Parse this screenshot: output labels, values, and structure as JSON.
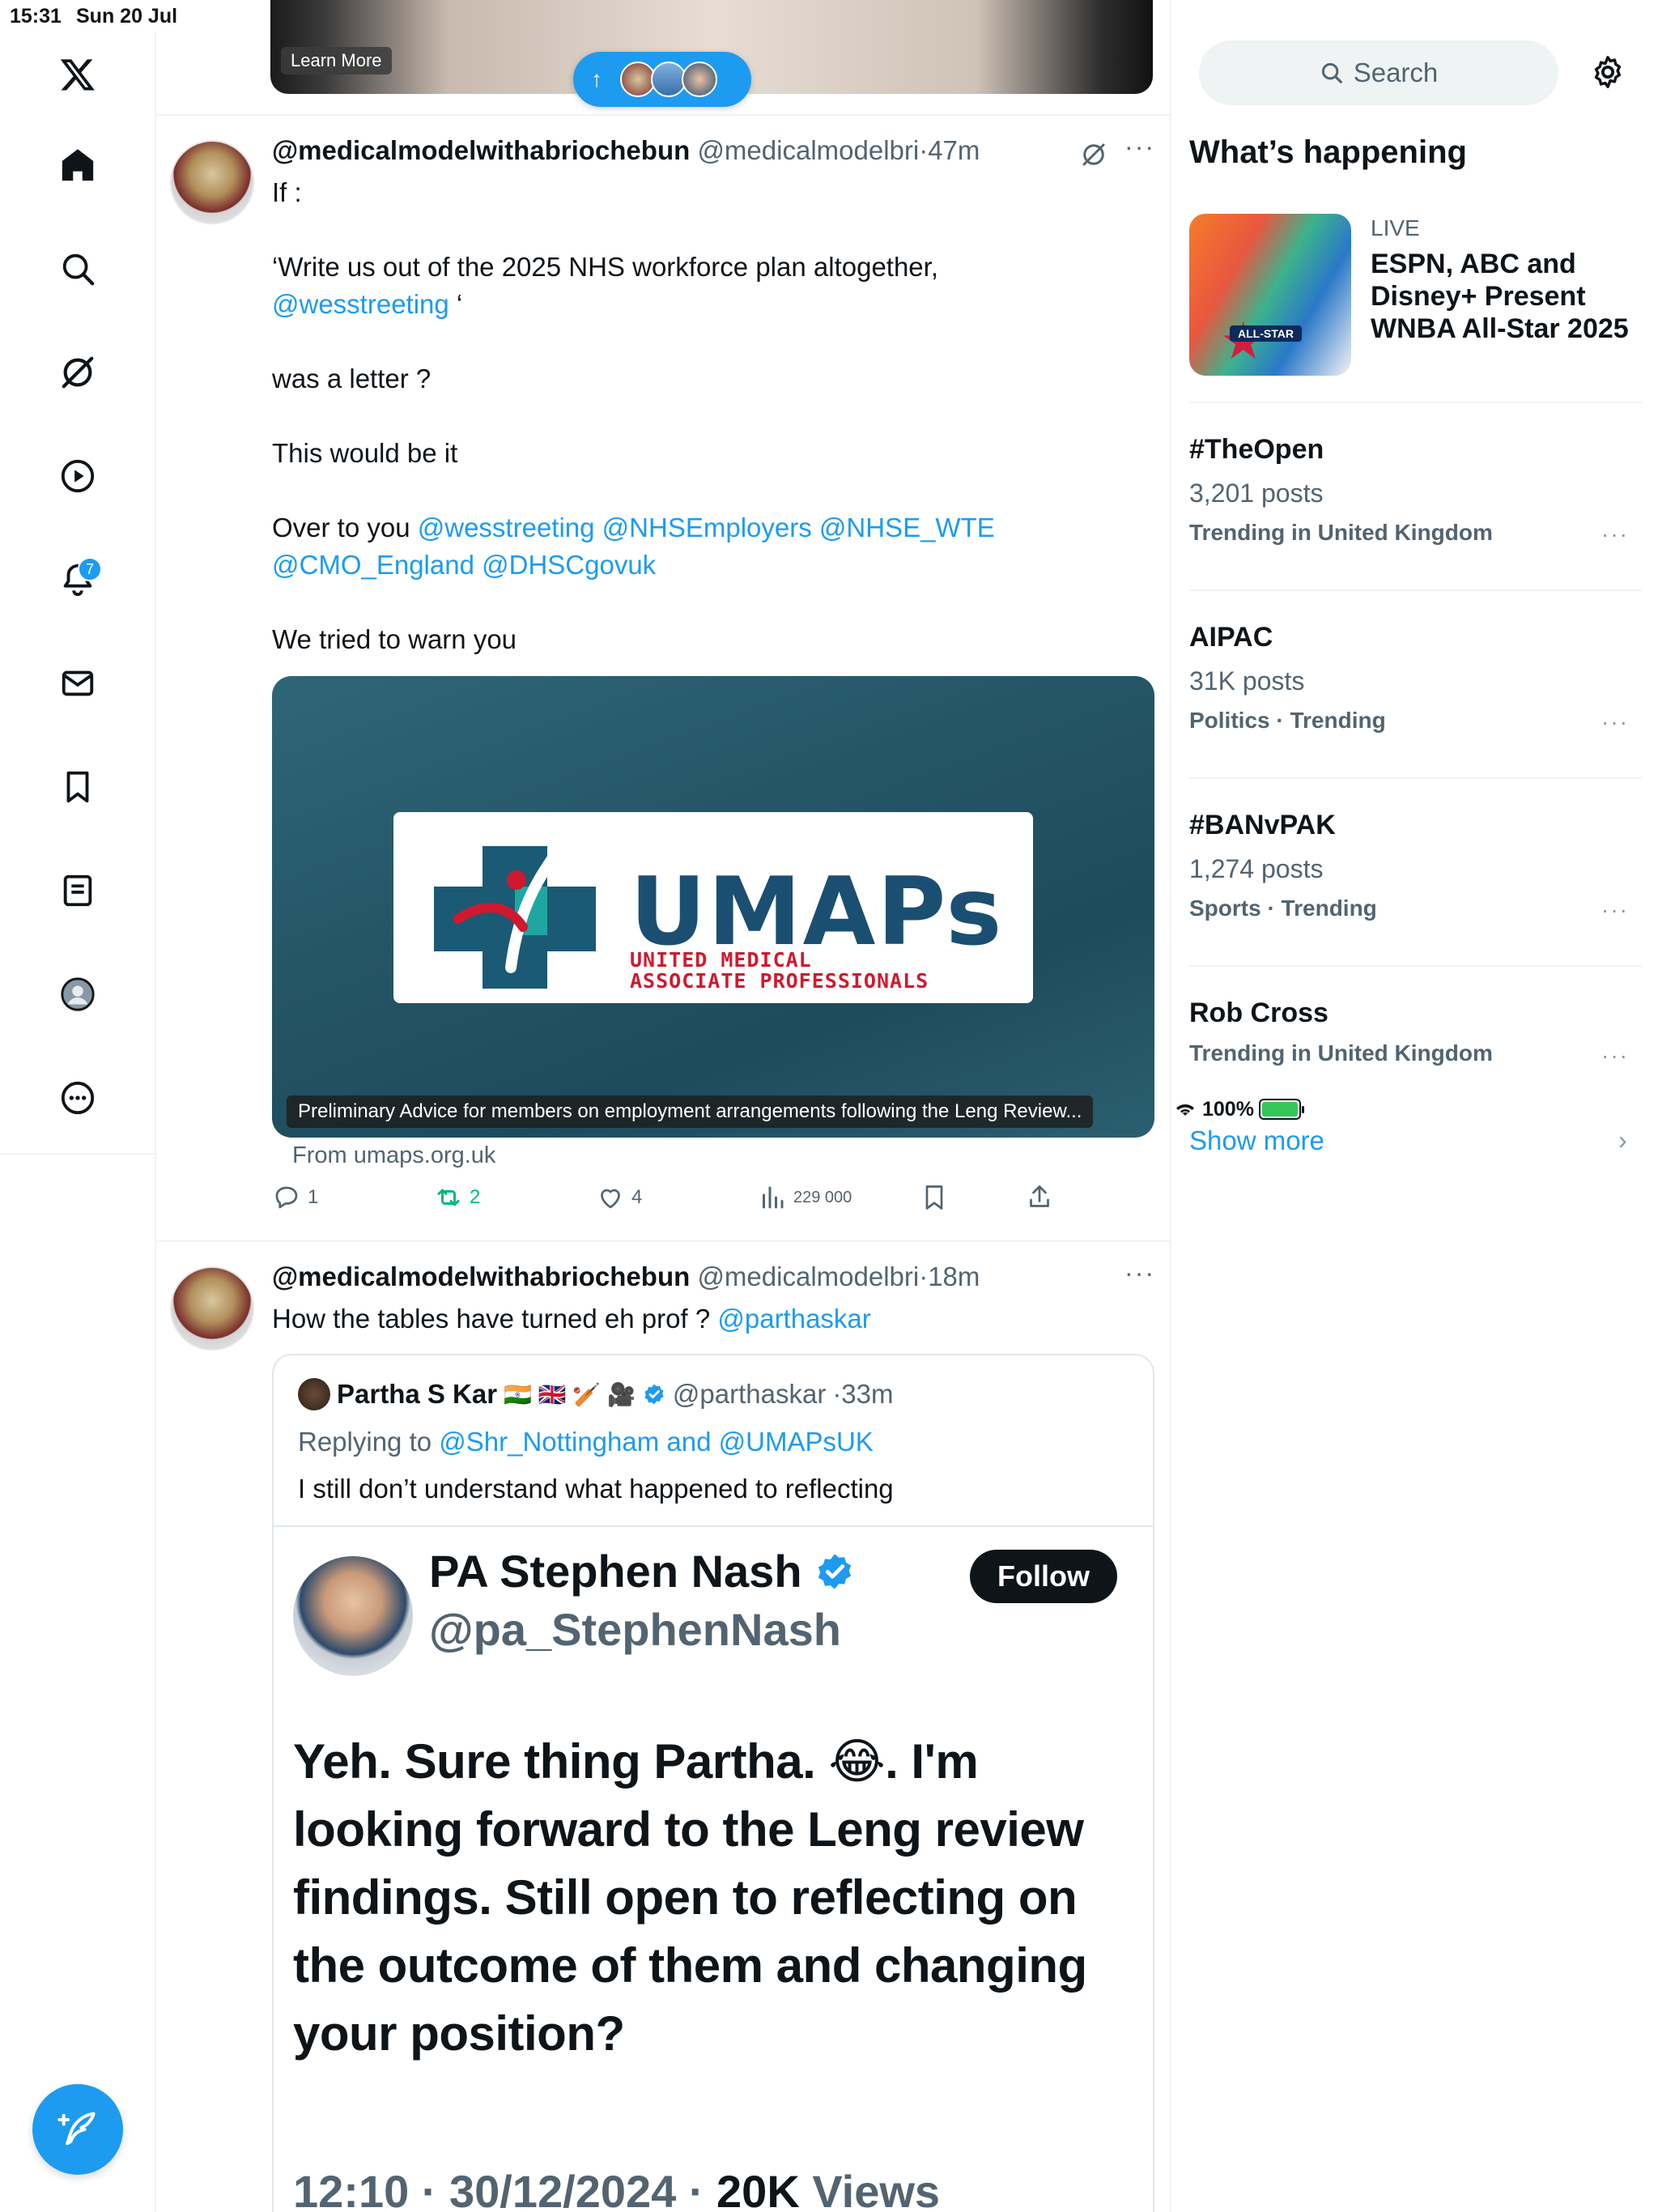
{
  "status_bar": {
    "time": "15:31",
    "date": "Sun 20 Jul",
    "battery": "100%"
  },
  "nav": {
    "notifications_badge": "7"
  },
  "top_video": {
    "learn_more": "Learn More"
  },
  "tweet1": {
    "name": "@medicalmodelwithabriochebun",
    "handle": "@medicalmodelbri",
    "time": "·47m",
    "line1": "If :",
    "line2": "‘Write us out of the 2025 NHS workforce plan altogether,",
    "mention1": "@wesstreeting",
    "quote_close": " ‘",
    "line3": "was a letter ?",
    "line4": "This would be it",
    "line5": "Over to you ",
    "mentions_a": "@wesstreeting @NHSEmployers @NHSE_WTE",
    "mentions_b": "@CMO_England @DHSCgovuk",
    "line6": "We tried to warn you",
    "card": {
      "logo_word": "UMAPs",
      "logo_sub1": "UNITED MEDICAL",
      "logo_sub2": "ASSOCIATE PROFESSIONALS",
      "caption": "Preliminary Advice for members on employment arrangements following the Leng Review...",
      "from": "From umaps.org.uk"
    },
    "actions": {
      "replies": "1",
      "reposts": "2",
      "likes": "4",
      "views": "229 000"
    }
  },
  "tweet2": {
    "name": "@medicalmodelwithabriochebun",
    "handle": "@medicalmodelbri",
    "time": "·18m",
    "text": "How the tables have turned eh prof ? ",
    "mention": "@parthaskar",
    "quote": {
      "name": "Partha S Kar",
      "flags": "🇮🇳 🇬🇧 🏏 🎥",
      "handle": "@parthaskar",
      "time": "·33m",
      "replying_prefix": "Replying to ",
      "replying_to": "@Shr_Nottingham and @UMAPsUK",
      "text": "I still don’t understand what happened to reflecting",
      "shot": {
        "name": "PA Stephen Nash",
        "handle": "@pa_StephenNash",
        "follow": "Follow",
        "text": "Yeh. Sure thing Partha. 😂. I'm looking forward to the Leng review findings. Still open to reflecting on the outcome of them and changing your position?",
        "meta_time": "12:10 · 30/12/2024 · ",
        "meta_views_num": "20K",
        "meta_views_label": " Views"
      }
    }
  },
  "sidebar": {
    "search_placeholder": "Search",
    "whats_happening": "What’s happening",
    "live_label": "LIVE",
    "live_title": "ESPN, ABC and Disney+ Present WNBA All-Star 2025",
    "live_img_text": "ALL-STAR",
    "trends": [
      {
        "title": "#TheOpen",
        "count": "3,201 posts",
        "context": "Trending in United Kingdom"
      },
      {
        "title": "AIPAC",
        "count": "31K posts",
        "context": "Politics · Trending"
      },
      {
        "title": "#BANvPAK",
        "count": "1,274 posts",
        "context": "Sports · Trending"
      },
      {
        "title": "Rob Cross",
        "count": "",
        "context": "Trending in United Kingdom"
      }
    ],
    "show_more": "Show more"
  },
  "colors": {
    "accent": "#1d9bf0",
    "repost_green": "#00ba7c",
    "text_secondary": "#536471"
  }
}
